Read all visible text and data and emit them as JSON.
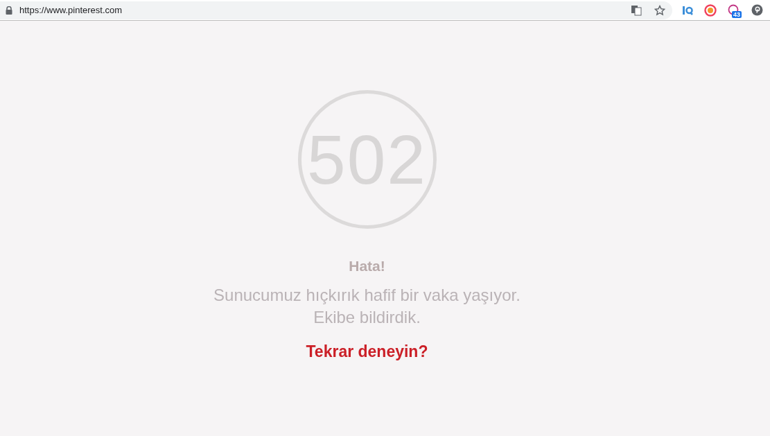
{
  "browser": {
    "url": "https://www.pinterest.com",
    "extension_badge": "43"
  },
  "error": {
    "code": "502",
    "title": "Hata!",
    "message_lines": [
      "Sunucumuz hıçkırık hafif bir vaka yaşıyor.",
      "Ekibe bildirdik."
    ],
    "retry_link": "Tekrar deneyin?"
  }
}
